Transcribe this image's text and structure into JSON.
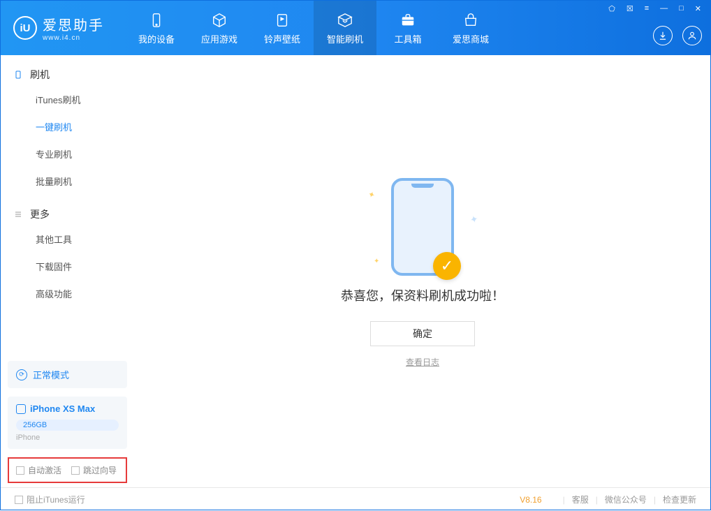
{
  "brand": {
    "cn": "爱思助手",
    "en": "www.i4.cn",
    "mark": "iU"
  },
  "tabs": [
    {
      "label": "我的设备",
      "icon": "device"
    },
    {
      "label": "应用游戏",
      "icon": "cube"
    },
    {
      "label": "铃声壁纸",
      "icon": "music"
    },
    {
      "label": "智能刷机",
      "icon": "refresh"
    },
    {
      "label": "工具箱",
      "icon": "case"
    },
    {
      "label": "爱思商城",
      "icon": "store"
    }
  ],
  "active_tab": 3,
  "sidebar": {
    "g1": {
      "title": "刷机",
      "items": [
        "iTunes刷机",
        "一键刷机",
        "专业刷机",
        "批量刷机"
      ],
      "active": 1
    },
    "g2": {
      "title": "更多",
      "items": [
        "其他工具",
        "下载固件",
        "高级功能"
      ]
    }
  },
  "mode": {
    "label": "正常模式"
  },
  "device": {
    "name": "iPhone XS Max",
    "storage": "256GB",
    "kind": "iPhone"
  },
  "opts": {
    "a": "自动激活",
    "b": "跳过向导"
  },
  "main": {
    "success": "恭喜您，保资料刷机成功啦！",
    "ok": "确定",
    "log": "查看日志"
  },
  "footer": {
    "block_itunes": "阻止iTunes运行",
    "version": "V8.16",
    "support": "客服",
    "wechat": "微信公众号",
    "update": "检查更新"
  }
}
